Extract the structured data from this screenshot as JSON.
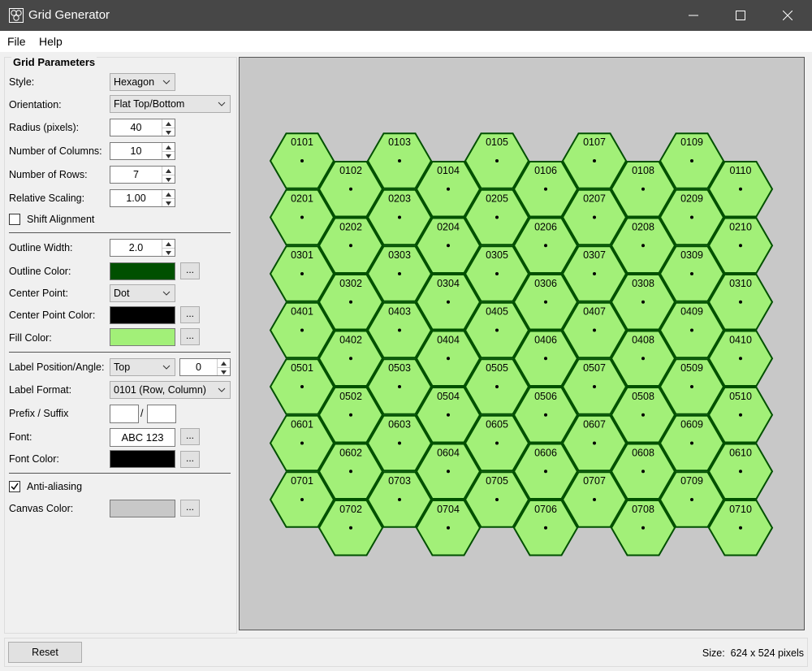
{
  "window": {
    "title": "Grid Generator",
    "icon": "app-hexes-icon"
  },
  "menu": {
    "file": "File",
    "help": "Help"
  },
  "params": {
    "group_title": "Grid Parameters",
    "style_label": "Style:",
    "style_value": "Hexagon",
    "orientation_label": "Orientation:",
    "orientation_value": "Flat Top/Bottom",
    "radius_label": "Radius (pixels):",
    "radius_value": "40",
    "columns_label": "Number of Columns:",
    "columns_value": "10",
    "rows_label": "Number of Rows:",
    "rows_value": "7",
    "scaling_label": "Relative Scaling:",
    "scaling_value": "1.00",
    "shift_label": "Shift Alignment",
    "shift_checked": false,
    "outline_width_label": "Outline Width:",
    "outline_width_value": "2.0",
    "outline_color_label": "Outline Color:",
    "outline_color": "#005000",
    "center_point_label": "Center Point:",
    "center_point_value": "Dot",
    "center_color_label": "Center Point Color:",
    "center_color": "#000000",
    "fill_color_label": "Fill Color:",
    "fill_color": "#a2f078",
    "label_pos_label": "Label Position/Angle:",
    "label_pos_value": "Top",
    "label_angle_value": "0",
    "label_format_label": "Label Format:",
    "label_format_value": "0101 (Row, Column)",
    "prefix_label": "Prefix / Suffix",
    "prefix_value": "",
    "prefix_sep": "/",
    "suffix_value": "",
    "font_label": "Font:",
    "font_value": "ABC 123",
    "font_color_label": "Font Color:",
    "font_color": "#000000",
    "antialias_label": "Anti-aliasing",
    "antialias_checked": true,
    "canvas_color_label": "Canvas Color:",
    "canvas_color": "#c8c8c8",
    "ellipsis": "..."
  },
  "grid": {
    "rows": 7,
    "columns": 10,
    "label_format": "RRCC"
  },
  "footer": {
    "reset": "Reset",
    "size_label": "Size:",
    "size_value": "624 x 524 pixels"
  }
}
